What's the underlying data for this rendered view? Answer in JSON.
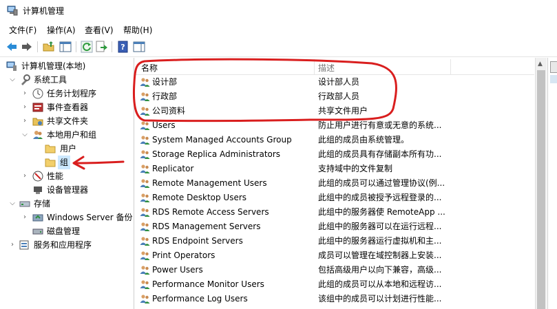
{
  "window": {
    "title": "计算机管理"
  },
  "menu": [
    {
      "label": "文件(F)"
    },
    {
      "label": "操作(A)"
    },
    {
      "label": "查看(V)"
    },
    {
      "label": "帮助(H)"
    }
  ],
  "toolbar": {
    "buttons": [
      "back-arrow-icon",
      "forward-arrow-icon",
      "up-folder-icon",
      "show-hide-tree-icon",
      "refresh-icon",
      "export-list-icon",
      "help-icon",
      "properties-view-icon"
    ]
  },
  "tree": [
    {
      "label": "计算机管理(本地)",
      "icon": "computer-management-icon"
    },
    {
      "label": "系统工具",
      "icon": "system-tools-icon"
    },
    {
      "label": "任务计划程序",
      "icon": "clock-icon"
    },
    {
      "label": "事件查看器",
      "icon": "event-viewer-icon"
    },
    {
      "label": "共享文件夹",
      "icon": "shared-folder-icon"
    },
    {
      "label": "本地用户和组",
      "icon": "users-groups-icon"
    },
    {
      "label": "用户",
      "icon": "folder-icon"
    },
    {
      "label": "组",
      "icon": "folder-icon"
    },
    {
      "label": "性能",
      "icon": "performance-icon"
    },
    {
      "label": "设备管理器",
      "icon": "device-manager-icon"
    },
    {
      "label": "存储",
      "icon": "storage-icon"
    },
    {
      "label": "Windows Server 备份",
      "icon": "backup-icon"
    },
    {
      "label": "磁盘管理",
      "icon": "disk-icon"
    },
    {
      "label": "服务和应用程序",
      "icon": "services-icon"
    }
  ],
  "list": {
    "columns": {
      "name": "名称",
      "desc": "描述"
    },
    "rows": [
      {
        "name": "设计部",
        "desc": "设计部人员"
      },
      {
        "name": "行政部",
        "desc": "行政部人员"
      },
      {
        "name": "公司资料",
        "desc": "共享文件用户"
      },
      {
        "name": "Users",
        "desc": "防止用户进行有意或无意的系统..."
      },
      {
        "name": "System Managed Accounts Group",
        "desc": "此组的成员由系统管理。"
      },
      {
        "name": "Storage Replica Administrators",
        "desc": "此组的成员具有存储副本所有功..."
      },
      {
        "name": "Replicator",
        "desc": "支持域中的文件复制"
      },
      {
        "name": "Remote Management Users",
        "desc": "此组的成员可以通过管理协议(例..."
      },
      {
        "name": "Remote Desktop Users",
        "desc": "此组中的成员被授予远程登录的..."
      },
      {
        "name": "RDS Remote Access Servers",
        "desc": "此组中的服务器使 RemoteApp ..."
      },
      {
        "name": "RDS Management Servers",
        "desc": "此组中的服务器可以在运行远程..."
      },
      {
        "name": "RDS Endpoint Servers",
        "desc": "此组中的服务器运行虚拟机和主..."
      },
      {
        "name": "Print Operators",
        "desc": "成员可以管理在域控制器上安装..."
      },
      {
        "name": "Power Users",
        "desc": "包括高级用户以向下兼容，高级..."
      },
      {
        "name": "Performance Monitor Users",
        "desc": "此组的成员可以从本地和远程访..."
      },
      {
        "name": "Performance Log Users",
        "desc": "该组中的成员可以计划进行性能..."
      }
    ]
  },
  "colors": {
    "annotation": "#d91e1e",
    "selection": "#cce8ff"
  }
}
